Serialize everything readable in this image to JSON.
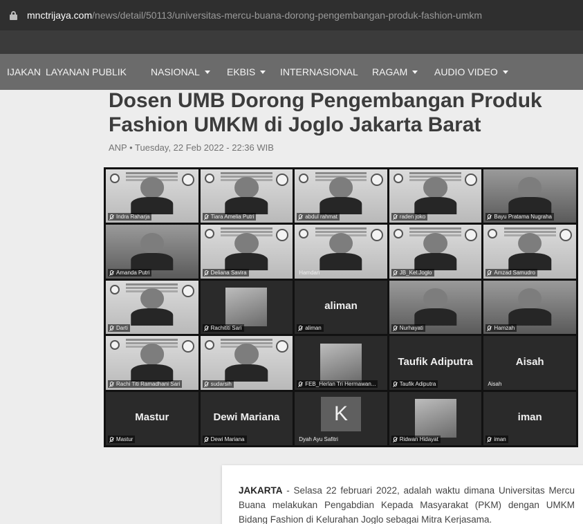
{
  "browser": {
    "url_host": "mnctrijaya.com",
    "url_path": "/news/detail/50113/universitas-mercu-buana-dorong-pengembangan-produk-fashion-umkm"
  },
  "nav": {
    "items": [
      {
        "label": "IJAKAN",
        "dropdown": false
      },
      {
        "label": "LAYANAN PUBLIK",
        "dropdown": false
      },
      {
        "label": "NASIONAL",
        "dropdown": true
      },
      {
        "label": "EKBIS",
        "dropdown": true
      },
      {
        "label": "INTERNASIONAL",
        "dropdown": false
      },
      {
        "label": "RAGAM",
        "dropdown": true
      },
      {
        "label": "AUDIO VIDEO",
        "dropdown": true
      }
    ]
  },
  "article": {
    "title": "Dosen UMB Dorong Pengembangan Produk Fashion UMKM di Joglo Jakarta Barat",
    "meta": "ANP • Tuesday, 22 Feb 2022 - 22:36 WIB",
    "lead_bold": "JAKARTA",
    "lead_text": " - Selasa 22 februari 2022, adalah waktu dimana Universitas Mercu Buana melakukan Pengabdian Kepada Masyarakat (PKM) dengan UMKM Bidang Fashion di Kelurahan Joglo sebagai Mitra Kerjasama."
  },
  "participants": [
    {
      "label": "Indra Raharja",
      "style": "poster"
    },
    {
      "label": "Tiara Amelia Putri",
      "style": "poster"
    },
    {
      "label": "abdul rahmat",
      "style": "poster"
    },
    {
      "label": "raden joko",
      "style": "poster"
    },
    {
      "label": "Bayu Pratama Nugraha",
      "style": "video"
    },
    {
      "label": "Amanda Putri",
      "style": "video"
    },
    {
      "label": "Deliana Savira",
      "style": "poster"
    },
    {
      "label": "Hamdan",
      "style": "poster"
    },
    {
      "label": "JB_Kel.Joglo",
      "style": "poster"
    },
    {
      "label": "Amzad Samudro",
      "style": "poster"
    },
    {
      "label": "Darti",
      "style": "poster"
    },
    {
      "label": "Rachititi Sari",
      "style": "photo"
    },
    {
      "label": "aliman",
      "style": "name",
      "big": "aliman"
    },
    {
      "label": "Nurhayati",
      "style": "video"
    },
    {
      "label": "Hamzah",
      "style": "video"
    },
    {
      "label": "Rachi Titi Ramadhani Sari",
      "style": "poster"
    },
    {
      "label": "sudarsih",
      "style": "poster"
    },
    {
      "label": "FEB_Herlan Tri Hermawan...",
      "style": "photo"
    },
    {
      "label": "Taufik Adiputra",
      "style": "name",
      "big": "Taufik Adiputra"
    },
    {
      "label": "Aisah",
      "style": "name",
      "big": "Aisah"
    },
    {
      "label": "Mastur",
      "style": "name",
      "big": "Mastur"
    },
    {
      "label": "Dewi Mariana",
      "style": "name",
      "big": "Dewi Mariana"
    },
    {
      "label": "Dyah Ayu Safitri",
      "style": "avatar",
      "avatar": "K"
    },
    {
      "label": "Ridwan Hidayat",
      "style": "photo"
    },
    {
      "label": "iman",
      "style": "name",
      "big": "iman"
    }
  ]
}
